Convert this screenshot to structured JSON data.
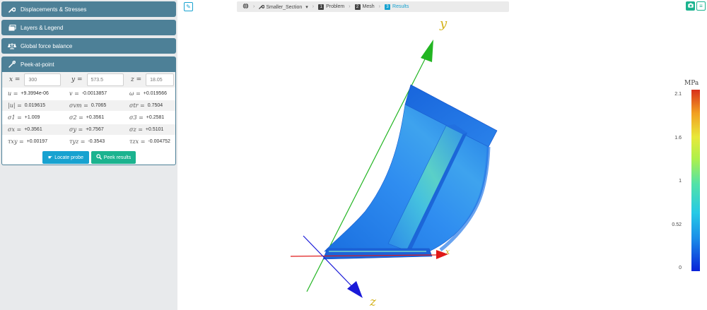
{
  "sidebar": {
    "sections": [
      {
        "label": "Displacements & Stresses",
        "icon": "wrench-icon"
      },
      {
        "label": "Layers & Legend",
        "icon": "layers-icon"
      },
      {
        "label": "Global force balance",
        "icon": "balance-scale-icon"
      },
      {
        "label": "Peek-at-point",
        "icon": "eyedropper-icon"
      }
    ],
    "peek": {
      "inputs": [
        {
          "symbol": "x =",
          "value": "300"
        },
        {
          "symbol": "y =",
          "value": "573.5"
        },
        {
          "symbol": "z =",
          "value": "18.05"
        }
      ],
      "rows": [
        [
          {
            "sym": "u =",
            "val": "+9.3994e-06"
          },
          {
            "sym": "v =",
            "val": "-0.0013857"
          },
          {
            "sym": "ω =",
            "val": "+0.019566"
          }
        ],
        [
          {
            "sym": "|u| =",
            "val": "0.019615"
          },
          {
            "sym": "σvm =",
            "val": "0.7065"
          },
          {
            "sym": "σtr =",
            "val": "0.7504"
          }
        ],
        [
          {
            "sym": "σ1 =",
            "val": "+1.009"
          },
          {
            "sym": "σ2 =",
            "val": "+0.3561"
          },
          {
            "sym": "σ3 =",
            "val": "+0.2581"
          }
        ],
        [
          {
            "sym": "σx =",
            "val": "+0.3561"
          },
          {
            "sym": "σy =",
            "val": "+0.7567"
          },
          {
            "sym": "σz =",
            "val": "+0.5101"
          }
        ],
        [
          {
            "sym": "τxy =",
            "val": "+0.00197"
          },
          {
            "sym": "τyz =",
            "val": "-0.3543"
          },
          {
            "sym": "τzx =",
            "val": "-0.004752"
          }
        ]
      ],
      "locate_label": "Locate probe",
      "peek_label": "Peek results"
    }
  },
  "topbar": {
    "breadcrumb": {
      "model": "Smaller_Section",
      "steps": [
        {
          "num": "1",
          "label": "Problem"
        },
        {
          "num": "2",
          "label": "Mesh"
        },
        {
          "num": "3",
          "label": "Results"
        }
      ]
    }
  },
  "viewport": {
    "axes": {
      "x": "x",
      "y": "y",
      "z": "z"
    },
    "axis_colors": {
      "x": "#e01818",
      "y": "#22b522",
      "z": "#1a1ad8"
    }
  },
  "legend": {
    "unit": "MPa",
    "ticks": [
      "2.1",
      "1.6",
      "1",
      "0.52",
      "0"
    ]
  }
}
